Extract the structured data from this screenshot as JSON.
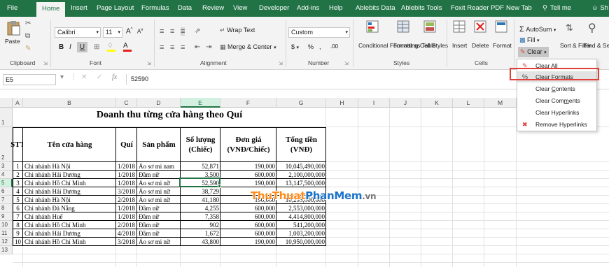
{
  "ribbon_tabs": [
    {
      "label": "File"
    },
    {
      "label": "Home"
    },
    {
      "label": "Insert"
    },
    {
      "label": "Page Layout"
    },
    {
      "label": "Formulas"
    },
    {
      "label": "Data"
    },
    {
      "label": "Review"
    },
    {
      "label": "View"
    },
    {
      "label": "Developer"
    },
    {
      "label": "Add-ins"
    },
    {
      "label": "Help"
    },
    {
      "label": "Ablebits Data"
    },
    {
      "label": "Ablebits Tools"
    },
    {
      "label": "Foxit Reader PDF"
    },
    {
      "label": "New Tab"
    },
    {
      "label": "Tell me"
    },
    {
      "label": "Sh"
    }
  ],
  "ribbon": {
    "clipboard": {
      "paste": "Paste",
      "label": "Clipboard"
    },
    "font": {
      "name": "Calibri",
      "size": "11",
      "label": "Font",
      "bold": "B",
      "italic": "I",
      "underline": "U",
      "grow": "A",
      "shrink": "A",
      "font_color": "A"
    },
    "alignment": {
      "wrap_text": "Wrap Text",
      "merge_center": "Merge & Center",
      "label": "Alignment"
    },
    "number": {
      "format": "Custom",
      "currency": "$",
      "percent": "%",
      "comma": ",",
      "inc_dec": ".00",
      "label": "Number"
    },
    "styles": {
      "conditional": "Conditional Formatting",
      "format_table": "Format as Table",
      "cell_styles": "Cell Styles",
      "label": "Styles"
    },
    "cells": {
      "insert": "Insert",
      "delete": "Delete",
      "format": "Format",
      "label": "Cells"
    },
    "editing": {
      "autosum": "AutoSum",
      "fill": "Fill",
      "clear": "Clear",
      "sort_filter": "Sort & Filter",
      "find_select": "Find & Select"
    }
  },
  "formula_bar": {
    "name_box": "E5",
    "fx": "fx",
    "content": "52590"
  },
  "columns": [
    "A",
    "B",
    "C",
    "D",
    "E",
    "F",
    "G",
    "H",
    "I",
    "J",
    "K",
    "L",
    "M"
  ],
  "row_numbers": [
    "1",
    "2",
    "3",
    "4",
    "5",
    "6",
    "7",
    "8",
    "9",
    "10",
    "11",
    "12",
    "13"
  ],
  "sheet": {
    "title": "Doanh thu từng cửa hàng theo Quí",
    "headers": {
      "stt": "STT",
      "store": "Tên cửa hàng",
      "quarter": "Quí",
      "product": "Sản phẩm",
      "qty_1": "Số lượng",
      "qty_2": "(Chiếc)",
      "price_1": "Đơn giá",
      "price_2": "(VNĐ/Chiếc)",
      "total_1": "Tổng tiền",
      "total_2": "(VNĐ)"
    },
    "rows": [
      {
        "stt": "1",
        "store": "Chi nhánh Hà Nội",
        "quarter": "1/2018",
        "product": "Áo sơ mi nam",
        "qty": "52,871",
        "price": "190,000",
        "total": "10,045,490,000"
      },
      {
        "stt": "2",
        "store": "Chi nhánh Hải Dương",
        "quarter": "1/2018",
        "product": "Đầm nữ",
        "qty": "3,500",
        "price": "600,000",
        "total": "2,100,000,000"
      },
      {
        "stt": "3",
        "store": "Chi nhánh Hồ Chí Minh",
        "quarter": "1/2018",
        "product": "Áo sơ mi nữ",
        "qty": "52,590",
        "price": "190,000",
        "total": "13,147,500,000"
      },
      {
        "stt": "4",
        "store": "Chi nhánh Hải Dương",
        "quarter": "3/2018",
        "product": "Áo sơ mi nữ",
        "qty": "38,729",
        "price": "",
        "total": ""
      },
      {
        "stt": "5",
        "store": "Chi nhánh Hà Nội",
        "quarter": "2/2018",
        "product": "Áo sơ mi nữ",
        "qty": "41,180",
        "price": "190,000",
        "total": "10,295,000,000"
      },
      {
        "stt": "6",
        "store": "Chi nhánh Đà Nẵng",
        "quarter": "1/2018",
        "product": "Đầm nữ",
        "qty": "4,255",
        "price": "600,000",
        "total": "2,553,000,000"
      },
      {
        "stt": "7",
        "store": "Chi nhánh Huế",
        "quarter": "1/2018",
        "product": "Đầm nữ",
        "qty": "7,358",
        "price": "600,000",
        "total": "4,414,800,000"
      },
      {
        "stt": "8",
        "store": "Chi nhánh Hồ Chí Minh",
        "quarter": "2/2018",
        "product": "Đầm nữ",
        "qty": "902",
        "price": "600,000",
        "total": "541,200,000"
      },
      {
        "stt": "9",
        "store": "Chi nhánh Hải Dương",
        "quarter": "4/2018",
        "product": "Đầm nữ",
        "qty": "1,672",
        "price": "600,000",
        "total": "1,003,200,000"
      },
      {
        "stt": "10",
        "store": "Chi nhánh Hồ Chí Minh",
        "quarter": "3/2018",
        "product": "Áo sơ mi nữ",
        "qty": "43,800",
        "price": "190,000",
        "total": "10,950,000,000"
      }
    ]
  },
  "clear_menu": {
    "items": [
      {
        "label": "Clear All",
        "icon": "eraser-icon"
      },
      {
        "label": "Clear Formats",
        "icon": "clear-formats-icon"
      },
      {
        "label": "Clear Contents",
        "icon": ""
      },
      {
        "label": "Clear Comments",
        "icon": ""
      },
      {
        "label": "Clear Hyperlinks",
        "icon": ""
      },
      {
        "label": "Remove Hyperlinks",
        "icon": "remove-link-icon"
      }
    ]
  },
  "watermark": {
    "part1": "ThuThuat",
    "part2": "PhanMem",
    "part3": ".vn"
  },
  "colors": {
    "excel_green": "#217346",
    "highlight_red": "#e0403a",
    "watermark_orange": "#ff8c1a",
    "watermark_blue": "#1b73c9"
  }
}
